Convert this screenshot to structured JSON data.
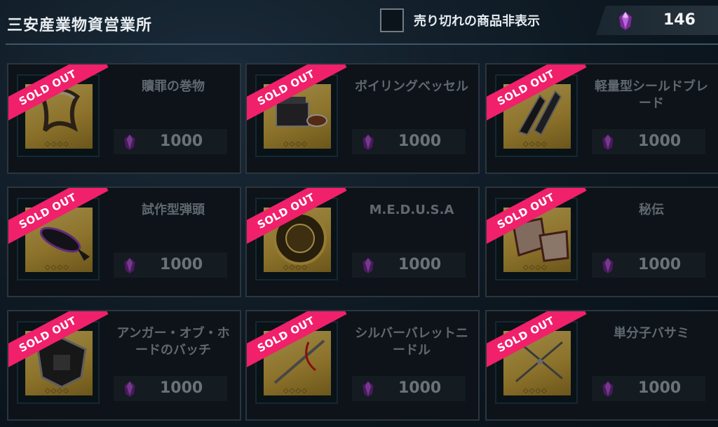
{
  "header": {
    "title": "三安産業物資営業所",
    "hide_sold_out_label": "売り切れの商品非表示",
    "hide_sold_out_checked": false,
    "currency_icon": "purple-crystal-icon",
    "currency_amount": "146"
  },
  "colors": {
    "sold_badge": "#f0206a",
    "thumb_gold": "#caa53f",
    "crystal": "#7a2a9a"
  },
  "items": [
    {
      "name": "贖罪の巻物",
      "price": "1000",
      "badge": "SOLD OUT",
      "rarity_dots": "◇◇◇◇",
      "icon": "scroll-icon"
    },
    {
      "name": "ボイリングベッセル",
      "price": "1000",
      "badge": "SOLD OUT",
      "rarity_dots": "◇◇◇◇",
      "icon": "boiling-vessel-icon"
    },
    {
      "name": "軽量型シールドブレード",
      "price": "1000",
      "badge": "SOLD OUT",
      "rarity_dots": "◇◇◇◇",
      "icon": "shield-blade-icon"
    },
    {
      "name": "試作型弾頭",
      "price": "1000",
      "badge": "SOLD OUT",
      "rarity_dots": "◇◇◇◇",
      "icon": "warhead-icon"
    },
    {
      "name": "M.E.D.U.S.A",
      "price": "1000",
      "badge": "SOLD OUT",
      "rarity_dots": "◇◇◇◇",
      "icon": "medusa-disc-icon"
    },
    {
      "name": "秘伝",
      "price": "1000",
      "badge": "SOLD OUT",
      "rarity_dots": "◇◇◇◇",
      "icon": "secret-scroll-icon"
    },
    {
      "name": "アンガー・オブ・ホードのバッチ",
      "price": "1000",
      "badge": "SOLD OUT",
      "rarity_dots": "◇◇◇◇",
      "icon": "badge-icon"
    },
    {
      "name": "シルバーバレットニードル",
      "price": "1000",
      "badge": "SOLD OUT",
      "rarity_dots": "◇◇◇◇",
      "icon": "needle-icon"
    },
    {
      "name": "単分子バサミ",
      "price": "1000",
      "badge": "SOLD OUT",
      "rarity_dots": "◇◇◇◇",
      "icon": "scissors-icon"
    }
  ]
}
